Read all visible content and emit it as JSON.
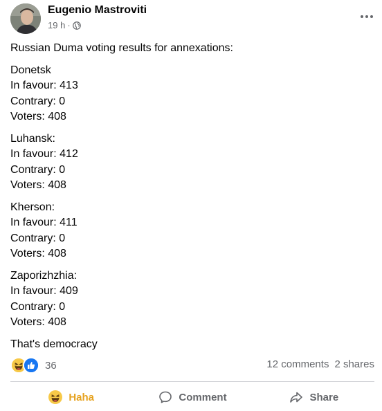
{
  "post": {
    "author": "Eugenio Mastroviti",
    "time": "19 h",
    "meta_separator": "·",
    "privacy_icon": "globe-icon",
    "more_icon": "more-horizontal-icon",
    "paragraphs": [
      [
        "Russian Duma voting results for annexations:"
      ],
      [
        "Donetsk",
        "In favour: 413",
        "Contrary: 0",
        "Voters: 408"
      ],
      [
        "Luhansk:",
        "In favour: 412",
        "Contrary: 0",
        "Voters: 408"
      ],
      [
        "Kherson:",
        "In favour: 411",
        "Contrary: 0",
        "Voters: 408"
      ],
      [
        "Zaporizhzhia:",
        "In favour: 409",
        "Contrary: 0",
        "Voters: 408"
      ],
      [
        "That's democracy"
      ]
    ]
  },
  "reactions": {
    "icons": [
      "haha-icon",
      "like-icon"
    ],
    "count": "36"
  },
  "counts": {
    "comments": "12 comments",
    "shares": "2 shares"
  },
  "actions": {
    "haha_label": "Haha",
    "comment_label": "Comment",
    "share_label": "Share"
  },
  "colors": {
    "text": "#050505",
    "secondary": "#65676b",
    "haha": "#e6a21f",
    "like": "#1877f2",
    "divider": "#ced0d4"
  }
}
